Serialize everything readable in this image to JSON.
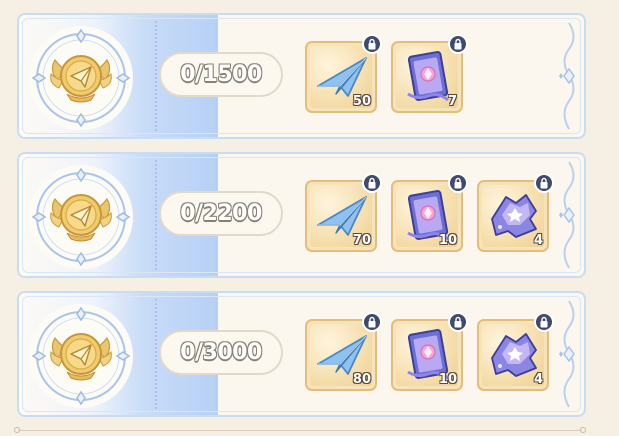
{
  "rows": [
    {
      "progress": "0/1500",
      "medal_icon": "gold-paper-plane-medal-icon",
      "rewards": [
        {
          "icon": "paper-plane-icon",
          "count": "50"
        },
        {
          "icon": "star-ticket-card-icon",
          "count": "7"
        }
      ]
    },
    {
      "progress": "0/2200",
      "medal_icon": "gold-paper-plane-medal-icon",
      "rewards": [
        {
          "icon": "paper-plane-icon",
          "count": "70"
        },
        {
          "icon": "star-ticket-card-icon",
          "count": "10"
        },
        {
          "icon": "torn-star-ticket-fragment-icon",
          "count": "4"
        }
      ]
    },
    {
      "progress": "0/3000",
      "medal_icon": "gold-paper-plane-medal-icon",
      "rewards": [
        {
          "icon": "paper-plane-icon",
          "count": "80"
        },
        {
          "icon": "star-ticket-card-icon",
          "count": "10"
        },
        {
          "icon": "torn-star-ticket-fragment-icon",
          "count": "4"
        }
      ]
    }
  ],
  "colors": {
    "background": "#f6efe3",
    "panel_blue": "#b6d0f5",
    "item_border": "#e4bd7a",
    "lock_badge": "#3e4b6d"
  }
}
